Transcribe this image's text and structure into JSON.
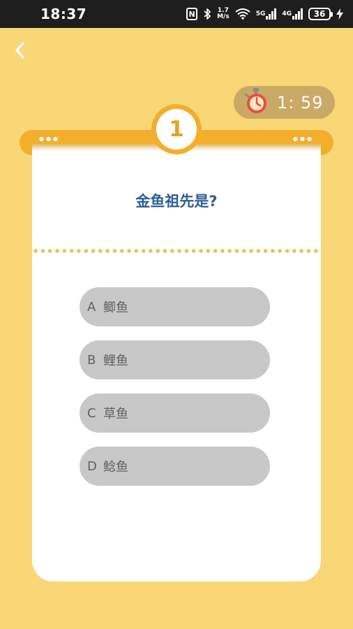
{
  "status_bar": {
    "time": "18:37",
    "nfc": "N",
    "speed_value": "1.7",
    "speed_unit": "M/s",
    "net1": "5G",
    "net2": "4G",
    "battery": "36"
  },
  "header": {
    "back_icon": "chevron-left-icon"
  },
  "timer": {
    "icon": "stopwatch-icon",
    "text": "1:  59"
  },
  "quiz": {
    "number": "1",
    "question": "金鱼祖先是?",
    "options": [
      {
        "letter": "A",
        "text": "鲫鱼"
      },
      {
        "letter": "B",
        "text": "鲤鱼"
      },
      {
        "letter": "C",
        "text": "草鱼"
      },
      {
        "letter": "D",
        "text": "鲶鱼"
      }
    ]
  },
  "colors": {
    "background": "#F9D676",
    "band": "#F3AF2C",
    "question": "#2D5F93",
    "option_bg": "#C8C8C8",
    "timer_bg": "#C9A965"
  }
}
